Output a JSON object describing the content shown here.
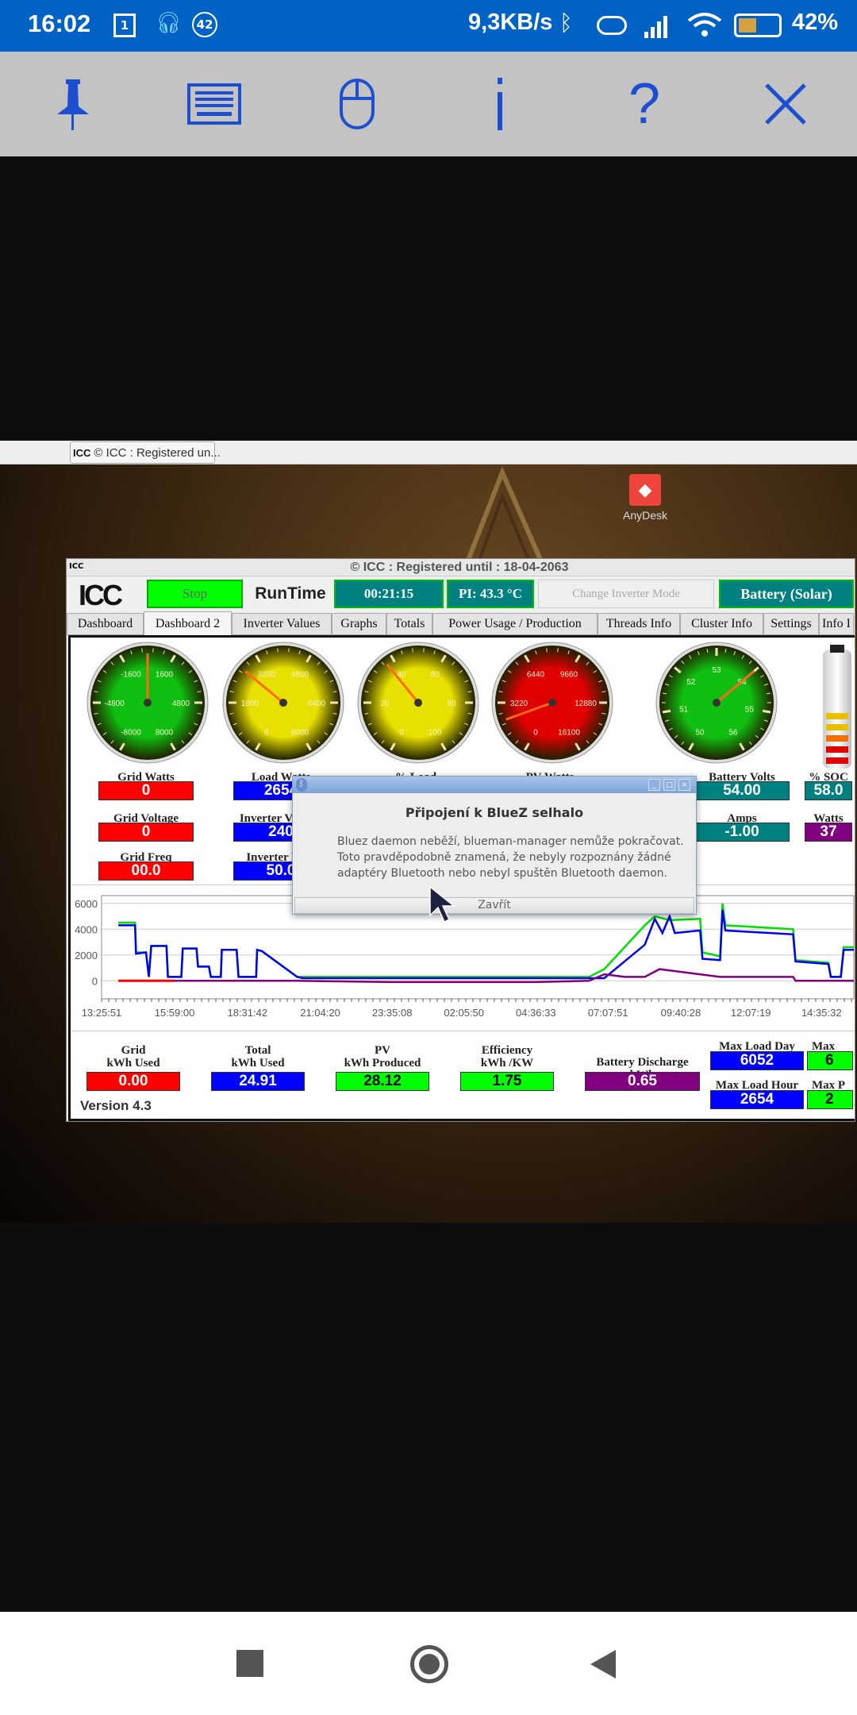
{
  "status_bar": {
    "time": "16:02",
    "calendar_day": "1",
    "notification_count": "42",
    "net_speed": "9,3KB/s",
    "battery": "42%",
    "battery_level_percent": 42,
    "bg_color": "#0062C4"
  },
  "remote_toolbar": {
    "icons": [
      "pin-icon",
      "keyboard-icon",
      "mouse-icon",
      "info-icon",
      "help-icon",
      "close-icon"
    ],
    "icon_color": "#1E4FD0"
  },
  "taskbar": {
    "task_label": "© ICC : Registered un..."
  },
  "desktop": {
    "anydesk_label": "AnyDesk"
  },
  "app": {
    "title": "© ICC : Registered until : 18-04-2063",
    "logo_text": "ICC",
    "stop_label": "Stop",
    "runtime_label": "RunTime",
    "runtime_value": "00:21:15",
    "pi_temp": "PI: 43.3 °C",
    "change_mode_label": "Change Inverter Mode",
    "mode_value": "Battery (Solar)",
    "tabs": [
      "Dashboard",
      "Dashboard 2",
      "Inverter Values",
      "Graphs",
      "Totals",
      "Power Usage / Production",
      "Threads Info",
      "Cluster Info",
      "Settings",
      "Info I"
    ],
    "active_tab": "Dashboard 2",
    "gauges": [
      {
        "name": "grid-watts",
        "min": -8000,
        "max": 8000,
        "labels": [
          "-8000",
          "-4800",
          "-1600",
          "1600",
          "4800",
          "8000"
        ],
        "value": 0,
        "color": "#10c010"
      },
      {
        "name": "load-watts",
        "min": 0,
        "max": 8000,
        "labels": [
          "0",
          "1600",
          "3200",
          "4800",
          "6400",
          "8000"
        ],
        "value": 2654,
        "color": "#e8e000"
      },
      {
        "name": "percent-load",
        "min": 0,
        "max": 100,
        "labels": [
          "0",
          "20",
          "40",
          "60",
          "80",
          "100"
        ],
        "value": 37,
        "color": "#e8e000"
      },
      {
        "name": "pv-watts",
        "min": 0,
        "max": 16100,
        "labels": [
          "0",
          "3220",
          "6440",
          "9660",
          "12880",
          "16100"
        ],
        "value": 2150,
        "color": "#e00000"
      },
      {
        "name": "battery-volts",
        "min": 50,
        "max": 56,
        "labels": [
          "50",
          "51",
          "52",
          "53",
          "54",
          "55",
          "56"
        ],
        "value": 54,
        "color": "#10c010"
      }
    ],
    "battery_soc_percent": 58,
    "metrics": [
      {
        "label": "Grid Watts",
        "value": "0",
        "color": "#FF0000"
      },
      {
        "label": "Load Watts",
        "value": "2654",
        "color": "#0000FF"
      },
      {
        "label": "% Load",
        "value": "",
        "color": ""
      },
      {
        "label": "PV Watts",
        "value": "",
        "color": ""
      },
      {
        "label": "Battery Volts",
        "value": "54.00",
        "color": "#008080"
      },
      {
        "label": "% SOC",
        "value": "58.0",
        "color": "#008080"
      },
      {
        "label": "Grid Voltage",
        "value": "0",
        "color": "#FF0000"
      },
      {
        "label": "Inverter Voltage",
        "value": "240",
        "color": "#0000FF"
      },
      {
        "label": "Amps",
        "value": "-1.00",
        "color": "#008080"
      },
      {
        "label": "Watts",
        "value": "37",
        "color": "#800080"
      },
      {
        "label": "Grid Freq",
        "value": "00.0",
        "color": "#FF0000"
      },
      {
        "label": "Inverter Freq",
        "value": "50.0",
        "color": "#0000FF"
      }
    ],
    "totals": [
      {
        "label1": "Grid",
        "label2": "kWh Used",
        "value": "0.00",
        "color": "#FF0000",
        "text": "#fff"
      },
      {
        "label1": "Total",
        "label2": "kWh Used",
        "value": "24.91",
        "color": "#0000FF",
        "text": "#fff"
      },
      {
        "label1": "PV",
        "label2": "kWh Produced",
        "value": "28.12",
        "color": "#00FF00",
        "text": "#000"
      },
      {
        "label1": "Efficiency",
        "label2": "kWh /KW",
        "value": "1.75",
        "color": "#00FF00",
        "text": "#000"
      },
      {
        "label1": "",
        "label2": "Battery Discharge kWh",
        "value": "0.65",
        "color": "#800080",
        "text": "#fff"
      }
    ],
    "max": {
      "load_day_label": "Max Load Day",
      "load_day": "6052",
      "load_hour_label": "Max Load Hour",
      "load_hour": "2654",
      "pv_day_label": "Max",
      "pv_day": "6",
      "pv_hour_label": "Max P",
      "pv_hour": "2"
    },
    "version": "Version 4.3"
  },
  "dialog": {
    "title": "Připojení k BlueZ selhalo",
    "lines": [
      "Bluez daemon neběží, blueman-manager nemůže pokračovat.",
      "Toto pravděpodobně znamená, že nebyly rozpoznány žádné",
      "adaptéry Bluetooth nebo nebyl spuštěn Bluetooth daemon."
    ],
    "close_label": "Zavřít"
  },
  "chart_data": {
    "type": "line",
    "x_ticks": [
      "13:25:51",
      "15:59:00",
      "18:31:42",
      "21:04:20",
      "23:35:08",
      "02:05:50",
      "04:36:33",
      "07:07:51",
      "09:40:28",
      "12:07:19",
      "14:35:32"
    ],
    "y_ticks": [
      0,
      2000,
      4000,
      6000
    ],
    "ylim": [
      -1400,
      6600
    ],
    "grid": true,
    "series": [
      {
        "color": "#00E000",
        "points": [
          [
            "14:01",
            4500
          ],
          [
            "14:36",
            4500
          ],
          [
            "14:38",
            2200
          ],
          [
            "14:59",
            2200
          ],
          [
            "15:05",
            300
          ],
          [
            "15:10",
            2700
          ],
          [
            "15:42",
            2700
          ],
          [
            "15:45",
            300
          ],
          [
            "16:13",
            300
          ],
          [
            "16:16",
            2500
          ],
          [
            "16:45",
            2500
          ],
          [
            "16:48",
            1100
          ],
          [
            "17:11",
            1100
          ],
          [
            "17:15",
            300
          ],
          [
            "17:36",
            300
          ],
          [
            "17:38",
            2400
          ],
          [
            "18:09",
            2400
          ],
          [
            "18:13",
            300
          ],
          [
            "18:50",
            300
          ],
          [
            "18:52",
            2400
          ],
          [
            "19:02",
            2300
          ],
          [
            "20:16",
            300
          ],
          [
            "06:28",
            300
          ],
          [
            "07:00",
            900
          ],
          [
            "08:25",
            4300
          ],
          [
            "08:46",
            5000
          ],
          [
            "09:17",
            4700
          ],
          [
            "10:21",
            4800
          ],
          [
            "10:26",
            2200
          ],
          [
            "11:03",
            1900
          ],
          [
            "11:08",
            6000
          ],
          [
            "11:14",
            4300
          ],
          [
            "13:36",
            4000
          ],
          [
            "13:41",
            1600
          ],
          [
            "14:50",
            1400
          ],
          [
            "14:55",
            300
          ],
          [
            "15:16",
            300
          ],
          [
            "15:22",
            2600
          ],
          [
            "15:57",
            2600
          ]
        ]
      },
      {
        "color": "#0000F0",
        "points": [
          [
            "14:01",
            4300
          ],
          [
            "14:36",
            4300
          ],
          [
            "14:38",
            2100
          ],
          [
            "14:59",
            2200
          ],
          [
            "15:05",
            300
          ],
          [
            "15:10",
            2700
          ],
          [
            "15:42",
            2700
          ],
          [
            "15:45",
            300
          ],
          [
            "16:13",
            300
          ],
          [
            "16:16",
            2500
          ],
          [
            "16:45",
            2500
          ],
          [
            "16:48",
            1100
          ],
          [
            "17:11",
            1100
          ],
          [
            "17:15",
            300
          ],
          [
            "17:36",
            300
          ],
          [
            "17:38",
            2400
          ],
          [
            "18:09",
            2400
          ],
          [
            "18:13",
            300
          ],
          [
            "18:50",
            300
          ],
          [
            "18:52",
            2400
          ],
          [
            "19:02",
            2300
          ],
          [
            "20:16",
            300
          ],
          [
            "20:27",
            200
          ],
          [
            "07:00",
            200
          ],
          [
            "08:25",
            2800
          ],
          [
            "08:46",
            4800
          ],
          [
            "09:02",
            3700
          ],
          [
            "09:17",
            5000
          ],
          [
            "09:28",
            3700
          ],
          [
            "10:21",
            3900
          ],
          [
            "10:26",
            1700
          ],
          [
            "11:03",
            1600
          ],
          [
            "11:08",
            5500
          ],
          [
            "11:14",
            3900
          ],
          [
            "13:36",
            3600
          ],
          [
            "13:41",
            1500
          ],
          [
            "14:50",
            1300
          ],
          [
            "14:55",
            300
          ],
          [
            "15:16",
            300
          ],
          [
            "15:22",
            2400
          ],
          [
            "15:57",
            2400
          ]
        ]
      },
      {
        "color": "#800080",
        "points": [
          [
            "14:01",
            0
          ],
          [
            "20:16",
            0
          ],
          [
            "23:35",
            -100
          ],
          [
            "04:36",
            -100
          ],
          [
            "06:28",
            0
          ],
          [
            "07:00",
            500
          ],
          [
            "07:43",
            300
          ],
          [
            "08:25",
            300
          ],
          [
            "08:56",
            900
          ],
          [
            "09:17",
            800
          ],
          [
            "10:21",
            500
          ],
          [
            "11:03",
            300
          ],
          [
            "13:36",
            300
          ],
          [
            "13:41",
            0
          ],
          [
            "15:57",
            0
          ]
        ]
      },
      {
        "color": "#FF0000",
        "points": [
          [
            "14:01",
            0
          ],
          [
            "15:57",
            0
          ]
        ]
      }
    ]
  }
}
